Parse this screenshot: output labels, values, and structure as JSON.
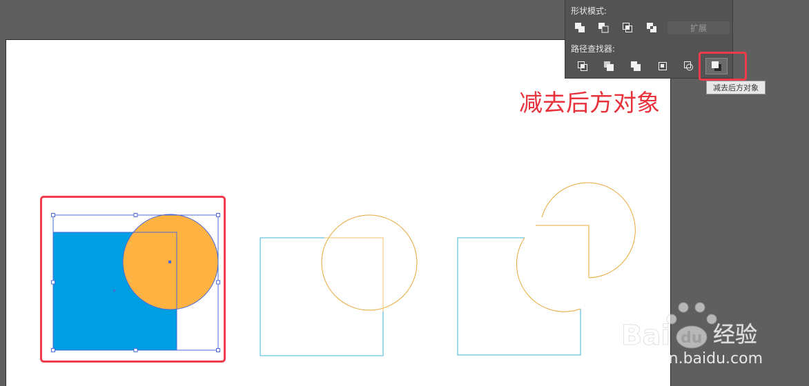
{
  "panel": {
    "shape_modes_label": "形状模式:",
    "pathfinder_label": "路径查找器:",
    "expand_label": "扩展",
    "shape_mode_buttons": [
      "unite-icon",
      "minus-front-icon",
      "intersect-icon",
      "exclude-icon"
    ],
    "pathfinder_buttons": [
      "divide-icon",
      "trim-icon",
      "merge-icon",
      "crop-icon",
      "outline-icon",
      "minus-back-icon"
    ]
  },
  "tooltip": {
    "text": "减去后方对象"
  },
  "annotation": {
    "caption": "减去后方对象"
  },
  "colors": {
    "blue_fill": "#009fe4",
    "orange_fill": "#fdb241",
    "selection": "#4a6ad8",
    "highlight_red": "#f13a4a",
    "outline_cyan": "#3fb6d6",
    "outline_orange": "#e8a83a"
  },
  "watermark": {
    "brand_latin_1": "Bai",
    "brand_latin_2": "du",
    "brand_cn": "经验",
    "url": "jingyan.baidu.com"
  }
}
